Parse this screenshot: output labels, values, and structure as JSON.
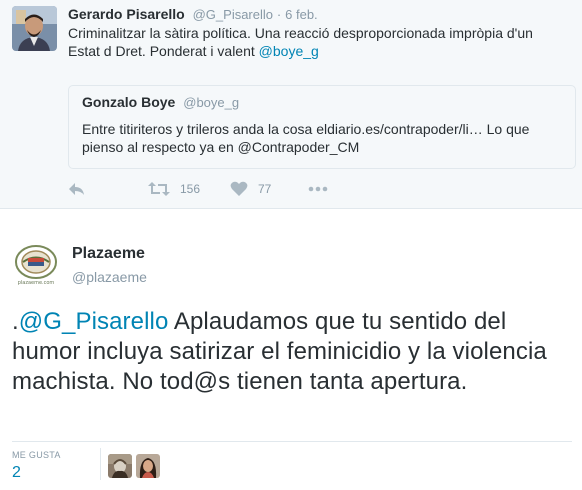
{
  "context_tweet": {
    "author_name": "Gerardo Pisarello",
    "author_handle": "@G_Pisarello",
    "separator": "·",
    "timestamp": "6 feb.",
    "text_before_link": "Criminalitzar la sàtira política. Una reacció desproporcionada impròpia d'un Estat d Dret. Ponderat i valent ",
    "mention": "@boye_g",
    "quoted": {
      "author_name": "Gonzalo Boye",
      "author_handle": "@boye_g",
      "text": "Entre titiriteros y trileros anda la cosa eldiario.es/contrapoder/li… Lo que pienso al respecto ya en @Contrapoder_CM"
    },
    "actions": {
      "reply_icon": "reply-icon",
      "retweet_icon": "retweet-icon",
      "retweet_count": "156",
      "like_icon": "heart-icon",
      "like_count": "77",
      "more_icon": "more-icon"
    }
  },
  "main_tweet": {
    "author_name": "Plazaeme",
    "author_handle": "@plazaeme",
    "text_prefix": ".",
    "mention": "@G_Pisarello",
    "text_rest": " Aplaudamos que tu sentido del humor incluya satirizar el feminicidio y la violencia machista. No tod@s tienen tanta apertura.",
    "likes_label": "ME GUSTA",
    "likes_count": "2",
    "avatar_caption": "plazaeme.com"
  },
  "colors": {
    "link": "#0084b4",
    "muted": "#8899a6",
    "icon": "#aab8c2",
    "context_bg": "#f5f8fa",
    "border": "#e1e8ed"
  }
}
